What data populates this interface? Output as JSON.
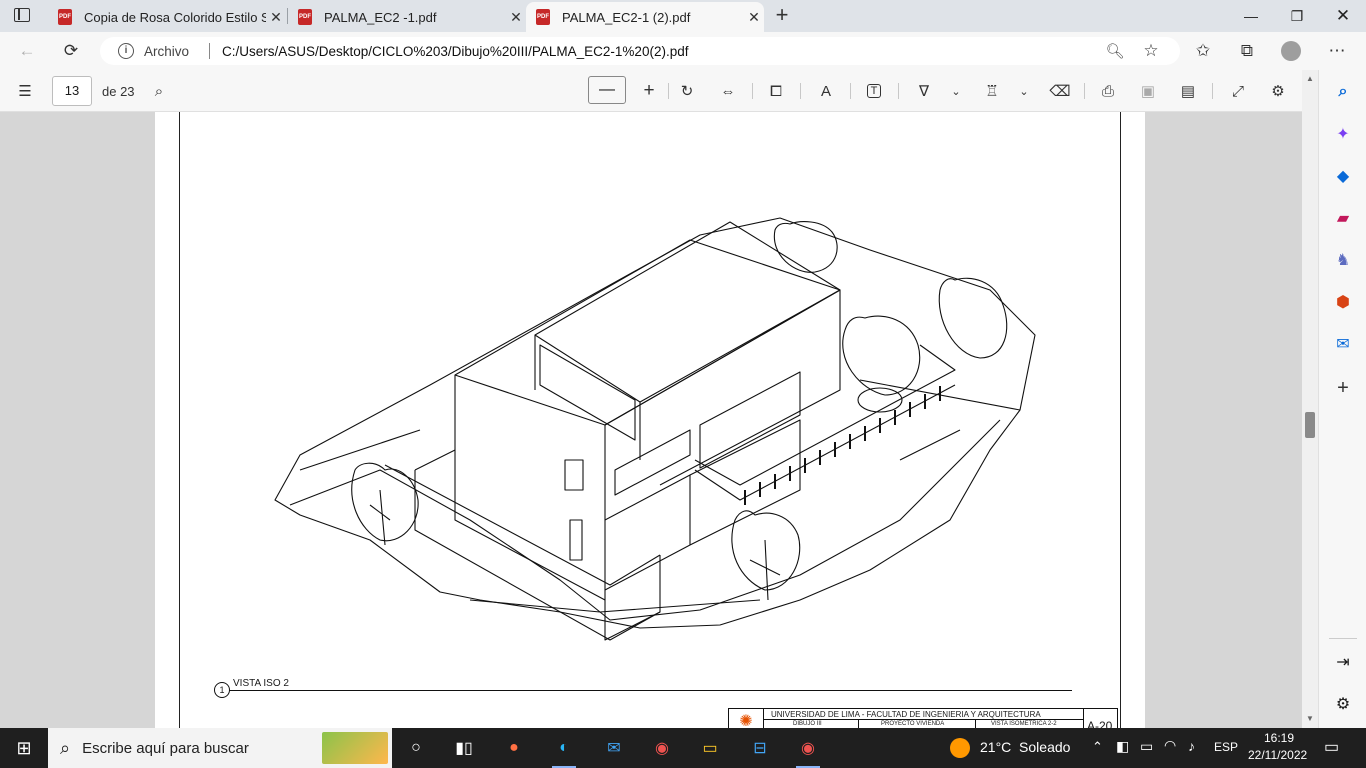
{
  "tabs": [
    {
      "label": "Copia de Rosa Colorido Estilo Se",
      "active": false
    },
    {
      "label": "PALMA_EC2 -1.pdf",
      "active": false
    },
    {
      "label": "PALMA_EC2-1 (2).pdf",
      "active": true
    }
  ],
  "address": {
    "security_label": "Archivo",
    "url": "C:/Users/ASUS/Desktop/CICLO%203/Dibujo%20III/PALMA_EC2-1%20(2).pdf"
  },
  "pdf_toolbar": {
    "page_number": "13",
    "page_count": "de 23"
  },
  "drawing": {
    "view_number": "1",
    "view_title": "VISTA ISO 2",
    "title_block": {
      "institution": "UNIVERSIDAD DE LIMA - FACULTAD DE INGENIERIA Y ARQUITECTURA",
      "course": "DIBUJO III",
      "project": "PROYECTO VIVIENDA",
      "sheet_desc": "VISTA ISOMETRICA 2-2",
      "sheet_code": "A-20"
    }
  },
  "taskbar": {
    "search_placeholder": "Escribe aquí para buscar",
    "weather": "21°C  Soleado",
    "language": "ESP",
    "time": "16:19",
    "date": "22/11/2022"
  },
  "colors": {
    "accent": "#0078d4",
    "pdf_red": "#c62828",
    "taskbar": "#1f1f1f"
  }
}
